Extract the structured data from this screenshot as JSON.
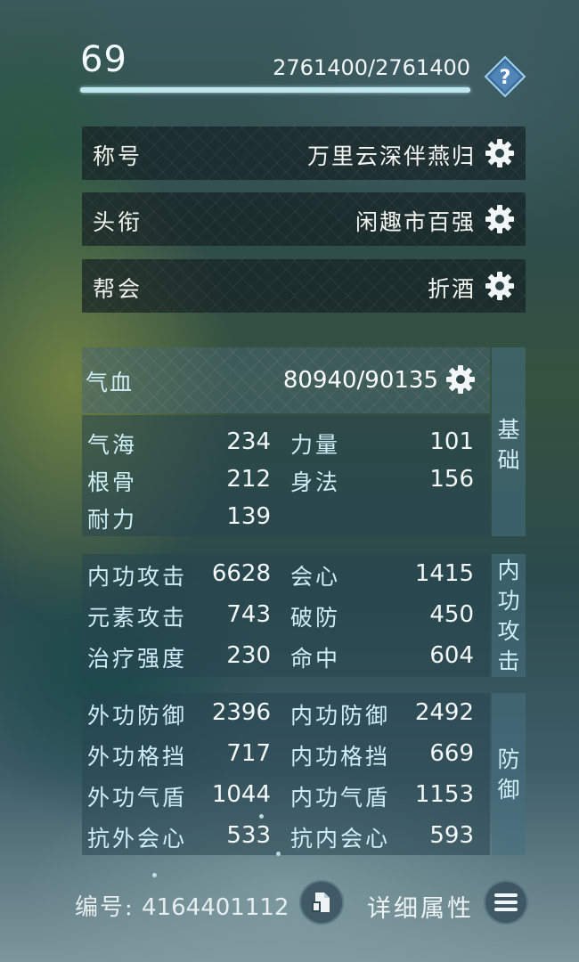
{
  "header": {
    "level": "69",
    "exp": "2761400/2761400",
    "exp_progress": 1.0
  },
  "profile": {
    "title": {
      "label": "称号",
      "value": "万里云深伴燕归"
    },
    "rank": {
      "label": "头衔",
      "value": "闲趣市百强"
    },
    "guild": {
      "label": "帮会",
      "value": "折酒"
    }
  },
  "stats": {
    "hp": {
      "label": "气血",
      "value": "80940/90135"
    },
    "basic_tab": "基础",
    "basic": [
      {
        "label": "气海",
        "value": "234"
      },
      {
        "label": "力量",
        "value": "101"
      },
      {
        "label": "根骨",
        "value": "212"
      },
      {
        "label": "身法",
        "value": "156"
      },
      {
        "label": "耐力",
        "value": "139"
      }
    ],
    "attack_tab": "内功攻击",
    "attack": [
      {
        "label": "内功攻击",
        "value": "6628"
      },
      {
        "label": "会心",
        "value": "1415"
      },
      {
        "label": "元素攻击",
        "value": "743"
      },
      {
        "label": "破防",
        "value": "450"
      },
      {
        "label": "治疗强度",
        "value": "230"
      },
      {
        "label": "命中",
        "value": "604"
      }
    ],
    "defense_tab": "防御",
    "defense": [
      {
        "label": "外功防御",
        "value": "2396"
      },
      {
        "label": "内功防御",
        "value": "2492"
      },
      {
        "label": "外功格挡",
        "value": "717"
      },
      {
        "label": "内功格挡",
        "value": "669"
      },
      {
        "label": "外功气盾",
        "value": "1044"
      },
      {
        "label": "内功气盾",
        "value": "1153"
      },
      {
        "label": "抗外会心",
        "value": "533"
      },
      {
        "label": "抗内会心",
        "value": "593"
      }
    ]
  },
  "footer": {
    "id_label": "编号:",
    "id_value": "4164401112",
    "detail_label": "详细属性"
  },
  "icons": {
    "help": "question-diamond-icon",
    "settings": "gear-icon",
    "copy": "copy-icon",
    "menu": "hamburger-menu-icon"
  },
  "colors": {
    "accent": "#cfeff8",
    "exp_bar": "#bfe7ee"
  }
}
